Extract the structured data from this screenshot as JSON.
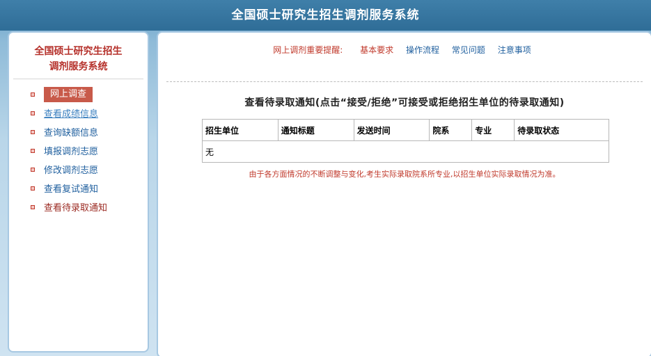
{
  "header": {
    "title": "全国硕士研究生招生调剂服务系统"
  },
  "sidebar": {
    "title_line1": "全国硕士研究生招生",
    "title_line2": "调剂服务系统",
    "items": [
      {
        "label": "网上调查"
      },
      {
        "label": "查看成绩信息"
      },
      {
        "label": "查询缺额信息"
      },
      {
        "label": "填报调剂志愿"
      },
      {
        "label": "修改调剂志愿"
      },
      {
        "label": "查看复试通知"
      },
      {
        "label": "查看待录取通知"
      }
    ]
  },
  "reminder": {
    "lead": "网上调剂重要提醒:",
    "links": [
      "基本要求",
      "操作流程",
      "常见问题",
      "注意事项"
    ]
  },
  "main": {
    "title": "查看待录取通知(点击“接受/拒绝”可接受或拒绝招生单位的待录取通知)",
    "table": {
      "headers": [
        "招生单位",
        "通知标题",
        "发送时间",
        "院系",
        "专业",
        "待录取状态"
      ],
      "empty_text": "无"
    },
    "notice": "由于各方面情况的不断调整与变化,考生实际录取院系所专业,以招生单位实际录取情况为准。"
  },
  "colors": {
    "header_bg": "#2f6d97",
    "accent_red": "#c0392b",
    "link_blue": "#1f5f9e",
    "active_item_bg": "#c85a4a"
  }
}
